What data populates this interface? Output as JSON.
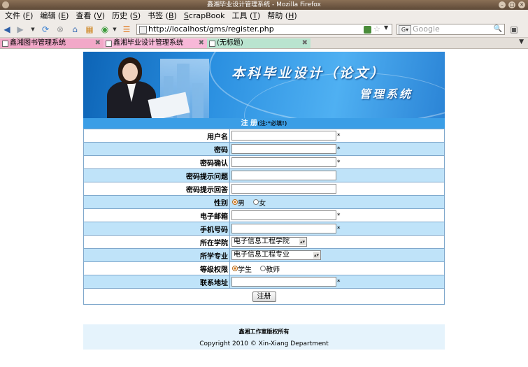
{
  "window": {
    "title": "鑫湘毕业设计管理系统 - Mozilla Firefox"
  },
  "menu": [
    {
      "label": "文件 (",
      "key": "F",
      "end": ")"
    },
    {
      "label": "编辑 (",
      "key": "E",
      "end": ")"
    },
    {
      "label": "查看 (",
      "key": "V",
      "end": ")"
    },
    {
      "label": "历史 (",
      "key": "S",
      "end": ")"
    },
    {
      "label": "书签 (",
      "key": "B",
      "end": ")"
    },
    {
      "label": "",
      "key": "S",
      "end": "crapBook"
    },
    {
      "label": "工具 (",
      "key": "T",
      "end": ")"
    },
    {
      "label": "帮助 (",
      "key": "H",
      "end": ")"
    }
  ],
  "navbar": {
    "url": "http://localhost/gms/register.php",
    "search_placeholder": "Google"
  },
  "tabs": [
    {
      "label": "鑫湘图书管理系统",
      "color": "#f2a8c8"
    },
    {
      "label": "鑫湘毕业设计管理系统",
      "color": "#f7b8d8"
    },
    {
      "label": "(无标题)",
      "color": "#b9e4cf"
    }
  ],
  "banner": {
    "title": "本科毕业设计（论文）",
    "subtitle": "管理系统"
  },
  "form": {
    "header": "注 册",
    "header_note": "(注:*必填!)",
    "username_label": "用户名",
    "password_label": "密码",
    "password_confirm_label": "密码确认",
    "question_label": "密码提示问题",
    "answer_label": "密码提示回答",
    "gender_label": "性别",
    "gender_male": "男",
    "gender_female": "女",
    "email_label": "电子邮箱",
    "phone_label": "手机号码",
    "college_label": "所在学院",
    "college_value": "电子信息工程学院",
    "major_label": "所学专业",
    "major_value": "电子信息工程专业",
    "role_label": "等级权限",
    "role_student": "学生",
    "role_teacher": "教师",
    "address_label": "联系地址",
    "required_mark": "*",
    "submit": "注册"
  },
  "footer": {
    "line1": "鑫湘工作室版权所有",
    "line2": "Copyright 2010 © Xin-Xiang Department"
  }
}
